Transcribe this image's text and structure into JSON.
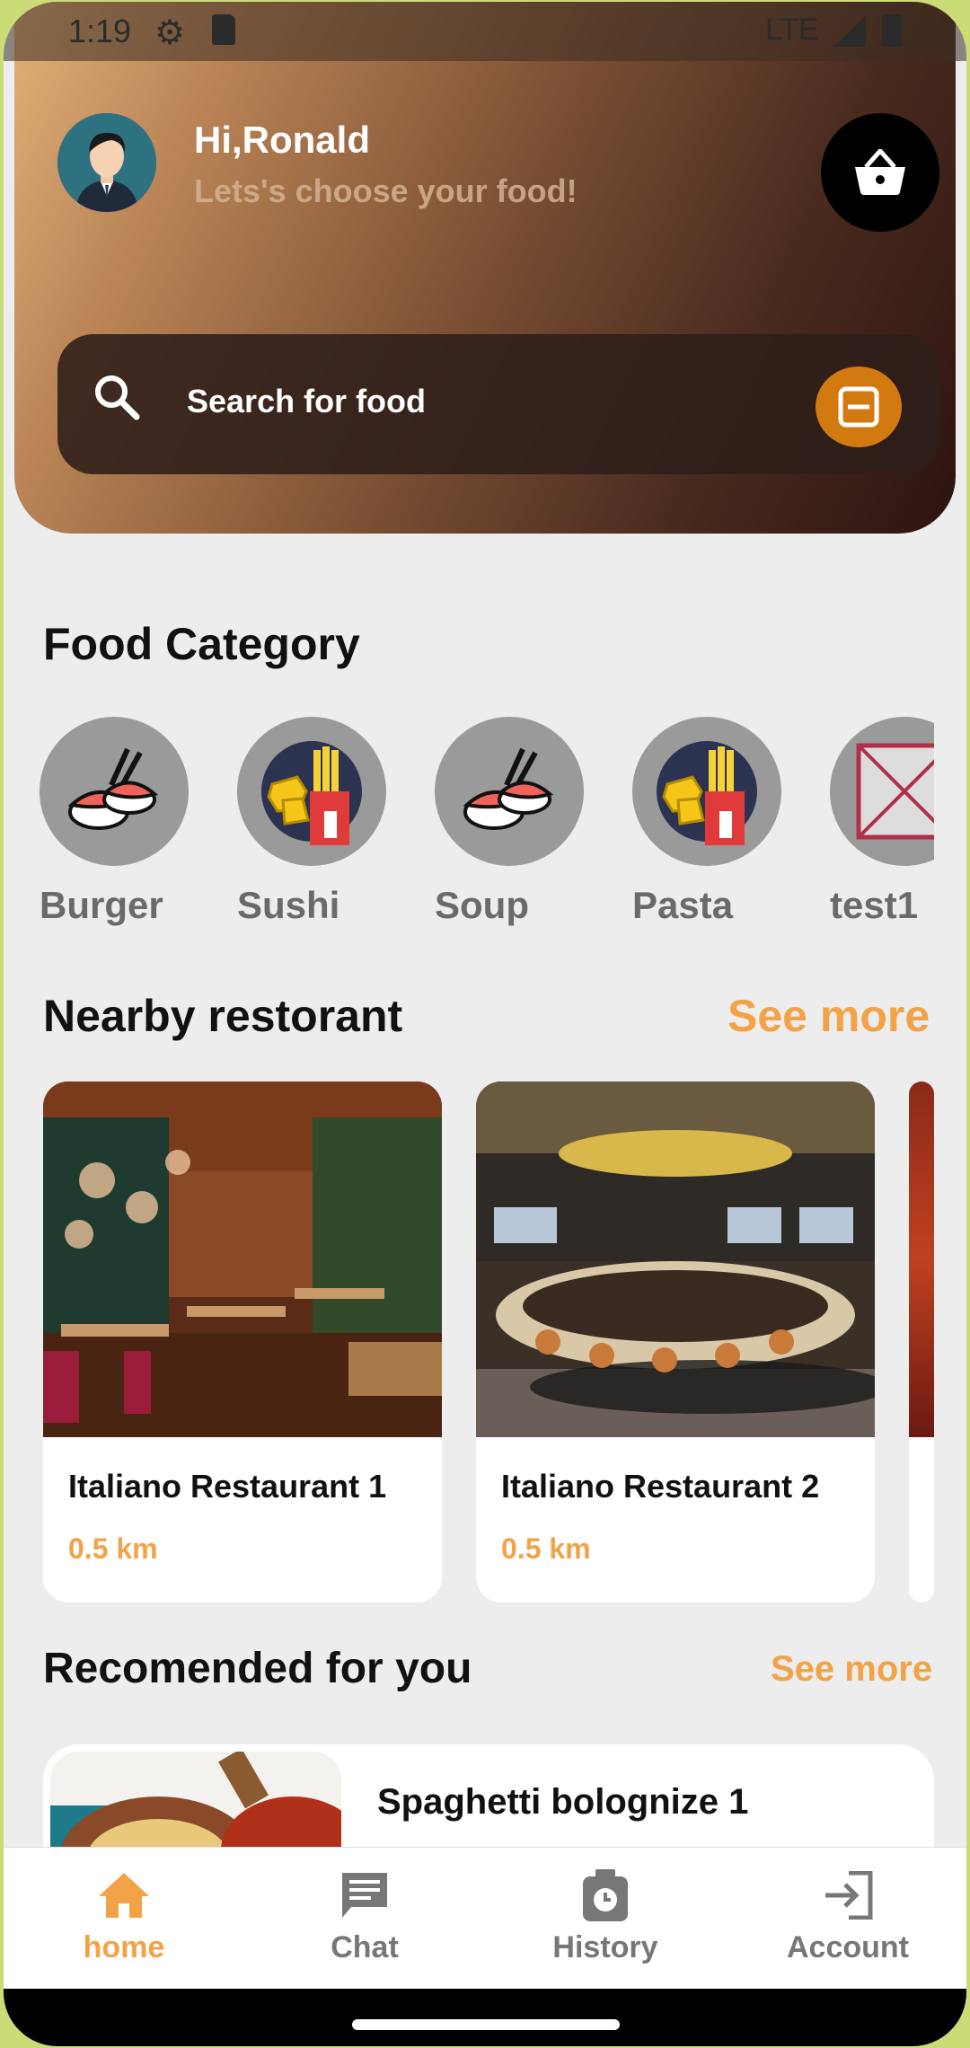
{
  "status_bar": {
    "time": "1:19",
    "network": "LTE"
  },
  "header": {
    "greeting": "Hi,Ronald",
    "subtitle": "Lets's choose your food!",
    "search_placeholder": "Search for food"
  },
  "categories": {
    "title": "Food Category",
    "items": [
      {
        "label": "Burger",
        "icon": "sushi-icon"
      },
      {
        "label": "Sushi",
        "icon": "fries-icon"
      },
      {
        "label": "Soup",
        "icon": "sushi-icon"
      },
      {
        "label": "Pasta",
        "icon": "fries-icon"
      },
      {
        "label": "test1",
        "icon": "broken-image-icon"
      }
    ]
  },
  "nearby": {
    "title": "Nearby restorant",
    "see_more": "See more",
    "items": [
      {
        "name": "Italiano Restaurant 1",
        "distance": "0.5 km"
      },
      {
        "name": "Italiano Restaurant 2",
        "distance": "0.5 km"
      }
    ]
  },
  "recommended": {
    "title": "Recomended for you",
    "see_more": "See more",
    "items": [
      {
        "name": "Spaghetti bolognize 1"
      }
    ]
  },
  "bottom_nav": {
    "items": [
      {
        "label": "home",
        "active": true
      },
      {
        "label": "Chat",
        "active": false
      },
      {
        "label": "History",
        "active": false
      },
      {
        "label": "Account",
        "active": false
      }
    ]
  },
  "colors": {
    "accent": "#f2a347",
    "filter": "#d27a10",
    "background": "#ededed"
  }
}
